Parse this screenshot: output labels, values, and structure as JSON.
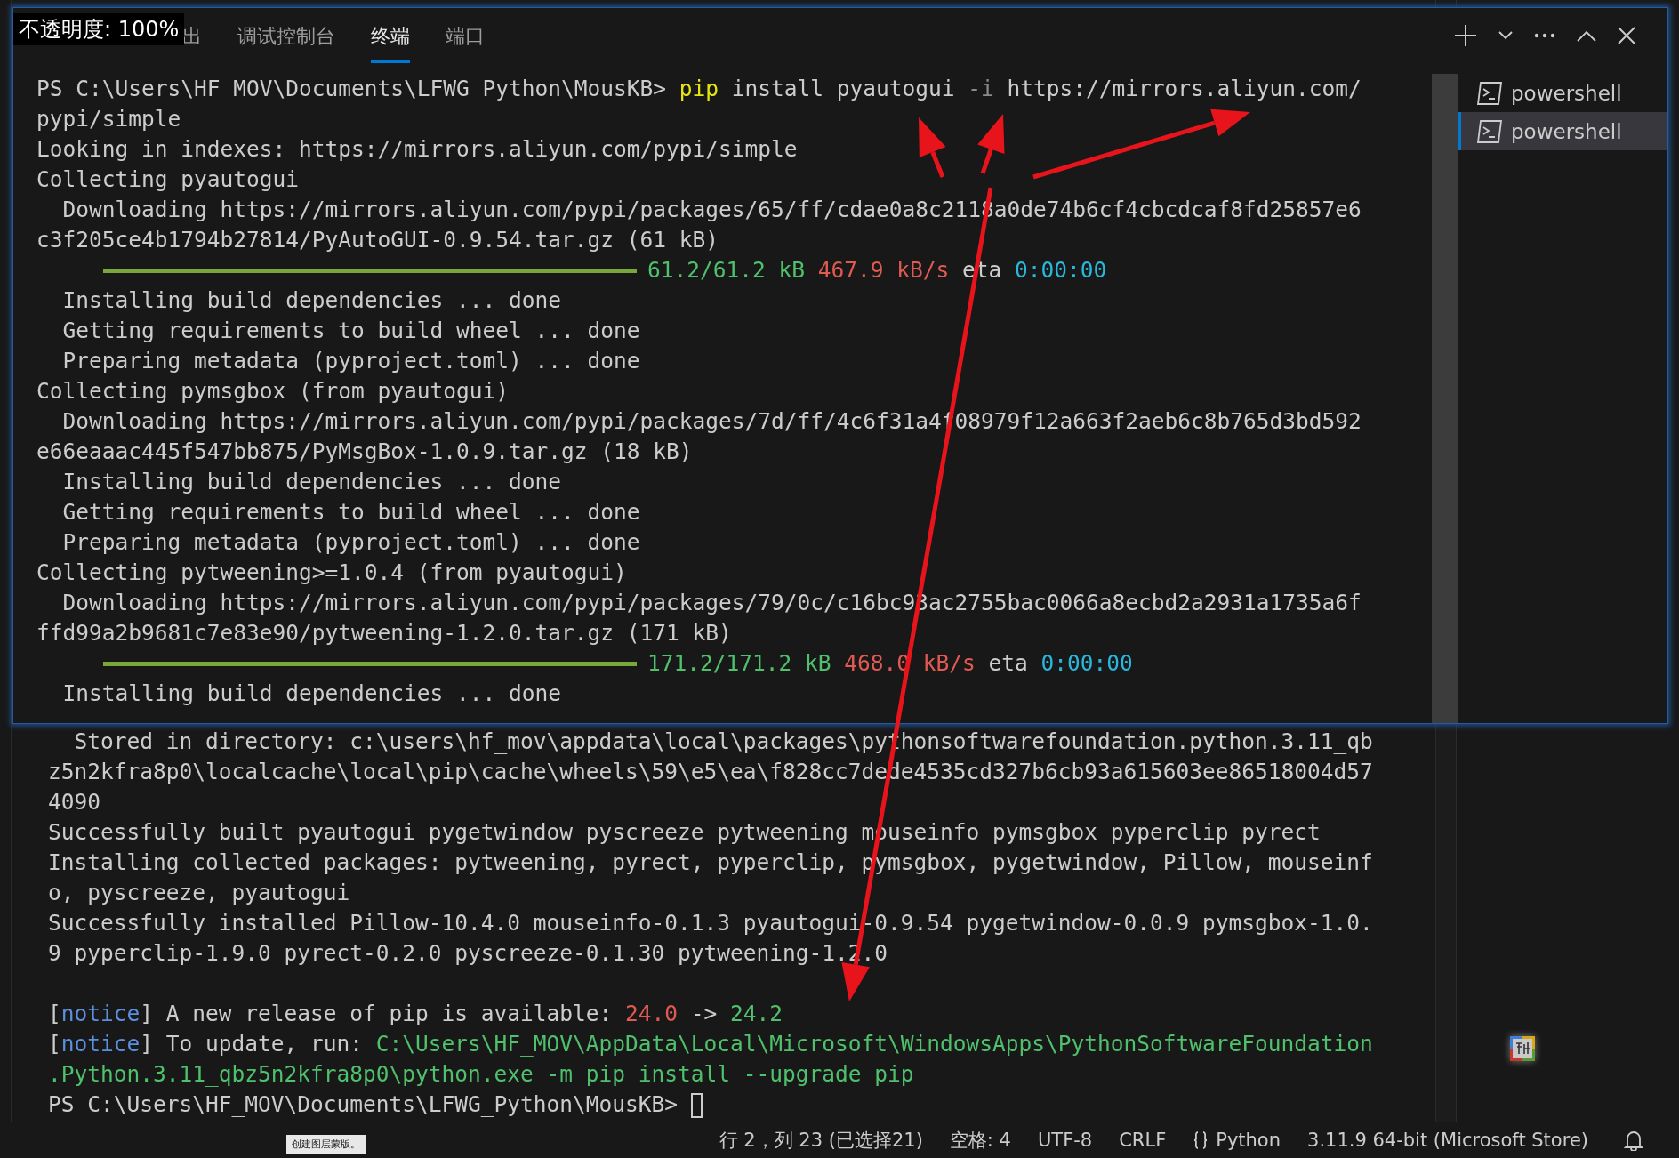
{
  "overlay_window": {
    "opacity_label": "不透明度: 100%",
    "tabs": [
      {
        "label": "出",
        "selected": false
      },
      {
        "label": "调试控制台",
        "selected": false
      },
      {
        "label": "终端",
        "selected": true
      },
      {
        "label": "端口",
        "selected": false
      }
    ],
    "lines": [
      {
        "kind": "text",
        "segments": [
          {
            "kind": "plain",
            "text": "PS C:\\Users\\HF_MOV\\Documents\\LFWG_Python\\MousKB> "
          },
          {
            "kind": "cmd",
            "text": "pip"
          },
          {
            "kind": "plain",
            "text": " install pyautogui "
          },
          {
            "kind": "flag",
            "text": "-i"
          },
          {
            "kind": "plain",
            "text": " https://mirrors.aliyun.com/"
          }
        ]
      },
      {
        "kind": "text",
        "segments": [
          {
            "kind": "plain",
            "text": "pypi/simple"
          }
        ]
      },
      {
        "kind": "text",
        "segments": [
          {
            "kind": "plain",
            "text": "Looking in indexes: https://mirrors.aliyun.com/pypi/simple"
          }
        ]
      },
      {
        "kind": "text",
        "segments": [
          {
            "kind": "plain",
            "text": "Collecting pyautogui"
          }
        ]
      },
      {
        "kind": "text",
        "segments": [
          {
            "kind": "plain",
            "text": "  Downloading https://mirrors.aliyun.com/pypi/packages/65/ff/cdae0a8c2118a0de74b6cf4cbcdcaf8fd25857e6"
          }
        ]
      },
      {
        "kind": "text",
        "segments": [
          {
            "kind": "plain",
            "text": "c3f205ce4b1794b27814/PyAutoGUI-0.9.54.tar.gz (61 kB)"
          }
        ]
      },
      {
        "kind": "progress",
        "level": 1,
        "segments": [
          {
            "kind": "green",
            "text": "61.2/61.2 kB "
          },
          {
            "kind": "red",
            "text": "467.9 kB/s"
          },
          {
            "kind": "plain",
            "text": " eta "
          },
          {
            "kind": "cyan",
            "text": "0:00:00"
          }
        ]
      },
      {
        "kind": "text",
        "segments": [
          {
            "kind": "plain",
            "text": "  Installing build dependencies ... done"
          }
        ]
      },
      {
        "kind": "text",
        "segments": [
          {
            "kind": "plain",
            "text": "  Getting requirements to build wheel ... done"
          }
        ]
      },
      {
        "kind": "text",
        "segments": [
          {
            "kind": "plain",
            "text": "  Preparing metadata (pyproject.toml) ... done"
          }
        ]
      },
      {
        "kind": "text",
        "segments": [
          {
            "kind": "plain",
            "text": "Collecting pymsgbox (from pyautogui)"
          }
        ]
      },
      {
        "kind": "text",
        "segments": [
          {
            "kind": "plain",
            "text": "  Downloading https://mirrors.aliyun.com/pypi/packages/7d/ff/4c6f31a4f08979f12a663f2aeb6c8b765d3bd592"
          }
        ]
      },
      {
        "kind": "text",
        "segments": [
          {
            "kind": "plain",
            "text": "e66eaaac445f547bb875/PyMsgBox-1.0.9.tar.gz (18 kB)"
          }
        ]
      },
      {
        "kind": "text",
        "segments": [
          {
            "kind": "plain",
            "text": "  Installing build dependencies ... done"
          }
        ]
      },
      {
        "kind": "text",
        "segments": [
          {
            "kind": "plain",
            "text": "  Getting requirements to build wheel ... done"
          }
        ]
      },
      {
        "kind": "text",
        "segments": [
          {
            "kind": "plain",
            "text": "  Preparing metadata (pyproject.toml) ... done"
          }
        ]
      },
      {
        "kind": "text",
        "segments": [
          {
            "kind": "plain",
            "text": "Collecting pytweening>=1.0.4 (from pyautogui)"
          }
        ]
      },
      {
        "kind": "text",
        "segments": [
          {
            "kind": "plain",
            "text": "  Downloading https://mirrors.aliyun.com/pypi/packages/79/0c/c16bc93ac2755bac0066a8ecbd2a2931a1735a6f"
          }
        ]
      },
      {
        "kind": "text",
        "segments": [
          {
            "kind": "plain",
            "text": "ffd99a2b9681c7e83e90/pytweening-1.2.0.tar.gz (171 kB)"
          }
        ]
      },
      {
        "kind": "progress",
        "level": 1,
        "segments": [
          {
            "kind": "green",
            "text": "171.2/171.2 kB "
          },
          {
            "kind": "red",
            "text": "468.0 kB/s"
          },
          {
            "kind": "plain",
            "text": " eta "
          },
          {
            "kind": "cyan",
            "text": "0:00:00"
          }
        ]
      },
      {
        "kind": "text",
        "segments": [
          {
            "kind": "plain",
            "text": "  Installing build dependencies ... done"
          }
        ]
      }
    ],
    "terminals": [
      {
        "label": "powershell",
        "selected": false
      },
      {
        "label": "powershell",
        "selected": true
      }
    ]
  },
  "terminal": {
    "lines": [
      {
        "kind": "text",
        "segments": [
          {
            "kind": "plain",
            "text": "  Stored in directory: c:\\users\\hf_mov\\appdata\\local\\packages\\pythonsoftwarefoundation.python.3.11_qb"
          }
        ]
      },
      {
        "kind": "text",
        "segments": [
          {
            "kind": "plain",
            "text": "z5n2kfra8p0\\localcache\\local\\pip\\cache\\wheels\\59\\e5\\ea\\f828cc7dede4535cd327b6cb93a615603ee86518004d57"
          }
        ]
      },
      {
        "kind": "text",
        "segments": [
          {
            "kind": "plain",
            "text": "4090"
          }
        ]
      },
      {
        "kind": "text",
        "segments": [
          {
            "kind": "plain",
            "text": "Successfully built pyautogui pygetwindow pyscreeze pytweening mouseinfo pymsgbox pyperclip pyrect"
          }
        ]
      },
      {
        "kind": "text",
        "segments": [
          {
            "kind": "plain",
            "text": "Installing collected packages: pytweening, pyrect, pyperclip, pymsgbox, pygetwindow, Pillow, mouseinf"
          }
        ]
      },
      {
        "kind": "text",
        "segments": [
          {
            "kind": "plain",
            "text": "o, pyscreeze, pyautogui"
          }
        ]
      },
      {
        "kind": "text",
        "segments": [
          {
            "kind": "plain",
            "text": "Successfully installed Pillow-10.4.0 mouseinfo-0.1.3 pyautogui-0.9.54 pygetwindow-0.0.9 pymsgbox-1.0."
          }
        ]
      },
      {
        "kind": "text",
        "segments": [
          {
            "kind": "plain",
            "text": "9 pyperclip-1.9.0 pyrect-0.2.0 pyscreeze-0.1.30 pytweening-1.2.0"
          }
        ]
      },
      {
        "kind": "blank"
      },
      {
        "kind": "text",
        "segments": [
          {
            "kind": "plain",
            "text": "["
          },
          {
            "kind": "blue",
            "text": "notice"
          },
          {
            "kind": "plain",
            "text": "] A new release of pip is available: "
          },
          {
            "kind": "red",
            "text": "24.0"
          },
          {
            "kind": "plain",
            "text": " -> "
          },
          {
            "kind": "green",
            "text": "24.2"
          }
        ]
      },
      {
        "kind": "text",
        "segments": [
          {
            "kind": "plain",
            "text": "["
          },
          {
            "kind": "blue",
            "text": "notice"
          },
          {
            "kind": "plain",
            "text": "] To update, run: "
          },
          {
            "kind": "green",
            "text": "C:\\Users\\HF_MOV\\AppData\\Local\\Microsoft\\WindowsApps\\PythonSoftwareFoundation"
          }
        ]
      },
      {
        "kind": "text",
        "segments": [
          {
            "kind": "green",
            "text": ".Python.3.11_qbz5n2kfra8p0\\python.exe -m pip install --upgrade pip"
          }
        ]
      },
      {
        "kind": "prompt",
        "segments": [
          {
            "kind": "plain",
            "text": "PS C:\\Users\\HF_MOV\\Documents\\LFWG_Python\\MousKB> "
          }
        ]
      }
    ]
  },
  "tooltip": "创建图层蒙版。",
  "status_bar": [
    {
      "kind": "text",
      "label": "行 2，列 23 (已选择21)"
    },
    {
      "kind": "text",
      "label": "空格: 4"
    },
    {
      "kind": "text",
      "label": "UTF-8"
    },
    {
      "kind": "text",
      "label": "CRLF"
    },
    {
      "kind": "language",
      "label": "Python"
    },
    {
      "kind": "text",
      "label": "3.11.9 64-bit (Microsoft Store)"
    }
  ]
}
